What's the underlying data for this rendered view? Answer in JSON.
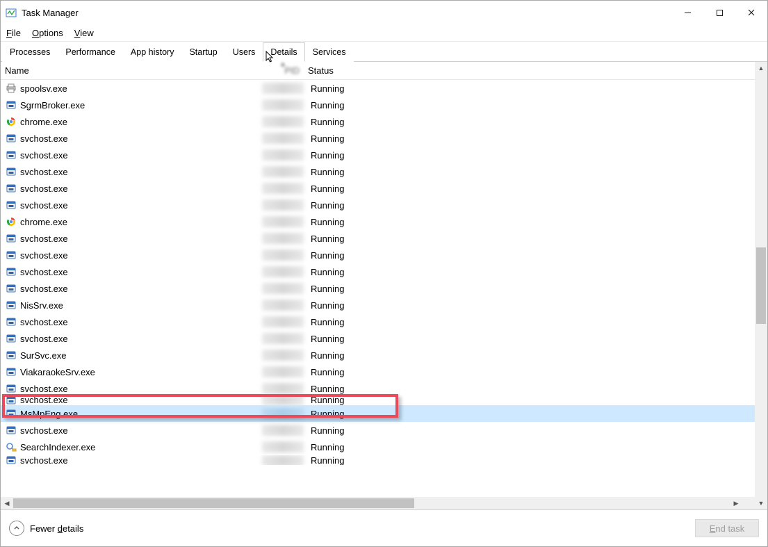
{
  "window": {
    "title": "Task Manager"
  },
  "menu": {
    "file": "File",
    "options": "Options",
    "view": "View"
  },
  "tabs": {
    "processes": "Processes",
    "performance": "Performance",
    "app_history": "App history",
    "startup": "Startup",
    "users": "Users",
    "details": "Details",
    "services": "Services",
    "active_index": 5
  },
  "columns": {
    "name": "Name",
    "pid_hidden": "PID",
    "status": "Status",
    "sort_column": "pid",
    "sort_dir": "asc"
  },
  "rows": [
    {
      "icon": "printer",
      "name": "spoolsv.exe",
      "status": "Running"
    },
    {
      "icon": "exe",
      "name": "SgrmBroker.exe",
      "status": "Running"
    },
    {
      "icon": "chrome",
      "name": "chrome.exe",
      "status": "Running"
    },
    {
      "icon": "exe",
      "name": "svchost.exe",
      "status": "Running"
    },
    {
      "icon": "exe",
      "name": "svchost.exe",
      "status": "Running"
    },
    {
      "icon": "exe",
      "name": "svchost.exe",
      "status": "Running"
    },
    {
      "icon": "exe",
      "name": "svchost.exe",
      "status": "Running"
    },
    {
      "icon": "exe",
      "name": "svchost.exe",
      "status": "Running"
    },
    {
      "icon": "chrome",
      "name": "chrome.exe",
      "status": "Running"
    },
    {
      "icon": "exe",
      "name": "svchost.exe",
      "status": "Running"
    },
    {
      "icon": "exe",
      "name": "svchost.exe",
      "status": "Running"
    },
    {
      "icon": "exe",
      "name": "svchost.exe",
      "status": "Running"
    },
    {
      "icon": "exe",
      "name": "svchost.exe",
      "status": "Running"
    },
    {
      "icon": "exe",
      "name": "NisSrv.exe",
      "status": "Running"
    },
    {
      "icon": "exe",
      "name": "svchost.exe",
      "status": "Running"
    },
    {
      "icon": "exe",
      "name": "svchost.exe",
      "status": "Running"
    },
    {
      "icon": "exe",
      "name": "SurSvc.exe",
      "status": "Running"
    },
    {
      "icon": "exe",
      "name": "ViakaraokeSrv.exe",
      "status": "Running"
    },
    {
      "icon": "exe",
      "name": "svchost.exe",
      "status": "Running"
    },
    {
      "icon": "exe",
      "name": "svchost.exe",
      "status": "Running",
      "partial": "top"
    },
    {
      "icon": "exe",
      "name": "MsMpEng.exe",
      "status": "Running",
      "selected": true,
      "highlighted": true
    },
    {
      "icon": "exe",
      "name": "svchost.exe",
      "status": "Running"
    },
    {
      "icon": "search",
      "name": "SearchIndexer.exe",
      "status": "Running"
    },
    {
      "icon": "exe",
      "name": "svchost.exe",
      "status": "Running",
      "partial": "bot"
    }
  ],
  "vscroll": {
    "thumb_top_pct": 41,
    "thumb_height_pct": 18
  },
  "footer": {
    "fewer_details": "Fewer details",
    "end_task": "End task",
    "end_task_enabled": false
  }
}
